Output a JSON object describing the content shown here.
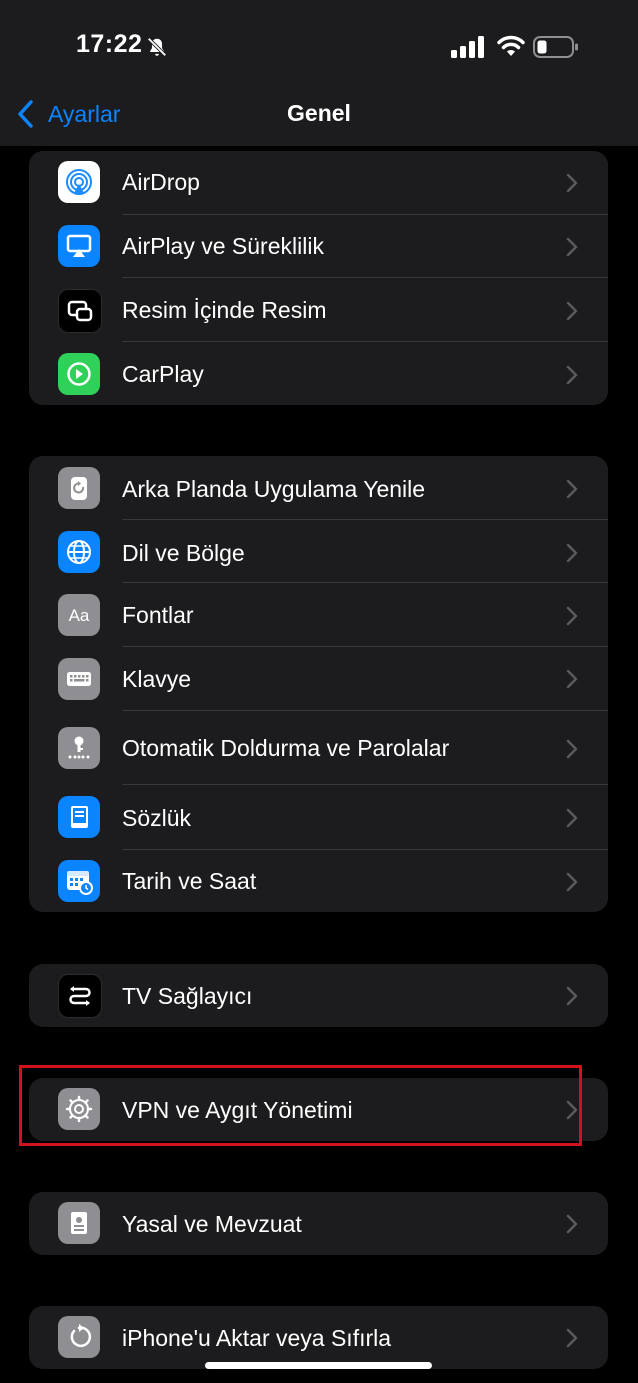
{
  "status_bar": {
    "time": "17:22",
    "icons": [
      "bell-slash-icon",
      "cellular-signal-icon",
      "wifi-icon",
      "battery-icon"
    ]
  },
  "nav": {
    "back_label": "Ayarlar",
    "title": "Genel"
  },
  "colors": {
    "accent": "#0a84ff",
    "highlight": "#d0121b",
    "background": "#000000",
    "cell": "#1c1c1e"
  },
  "groups": [
    {
      "items": [
        {
          "label": "AirDrop",
          "icon": "airdrop-icon"
        },
        {
          "label": "AirPlay ve Süreklilik",
          "icon": "airplay-icon"
        },
        {
          "label": "Resim İçinde Resim",
          "icon": "picture-in-picture-icon"
        },
        {
          "label": "CarPlay",
          "icon": "carplay-icon"
        }
      ]
    },
    {
      "items": [
        {
          "label": "Arka Planda Uygulama Yenile",
          "icon": "background-refresh-icon"
        },
        {
          "label": "Dil ve Bölge",
          "icon": "globe-icon"
        },
        {
          "label": "Fontlar",
          "icon": "fonts-icon"
        },
        {
          "label": "Klavye",
          "icon": "keyboard-icon"
        },
        {
          "label": "Otomatik Doldurma ve Parolalar",
          "icon": "autofill-key-icon"
        },
        {
          "label": "Sözlük",
          "icon": "dictionary-icon"
        },
        {
          "label": "Tarih ve Saat",
          "icon": "calendar-clock-icon"
        }
      ]
    },
    {
      "items": [
        {
          "label": "TV Sağlayıcı",
          "icon": "tv-provider-icon"
        }
      ]
    },
    {
      "items": [
        {
          "label": "VPN ve Aygıt Yönetimi",
          "icon": "gear-icon"
        }
      ]
    },
    {
      "items": [
        {
          "label": "Yasal ve Mevzuat",
          "icon": "legal-document-icon"
        }
      ]
    },
    {
      "items": [
        {
          "label": "iPhone'u Aktar veya Sıfırla",
          "icon": "reset-icon"
        }
      ]
    }
  ]
}
